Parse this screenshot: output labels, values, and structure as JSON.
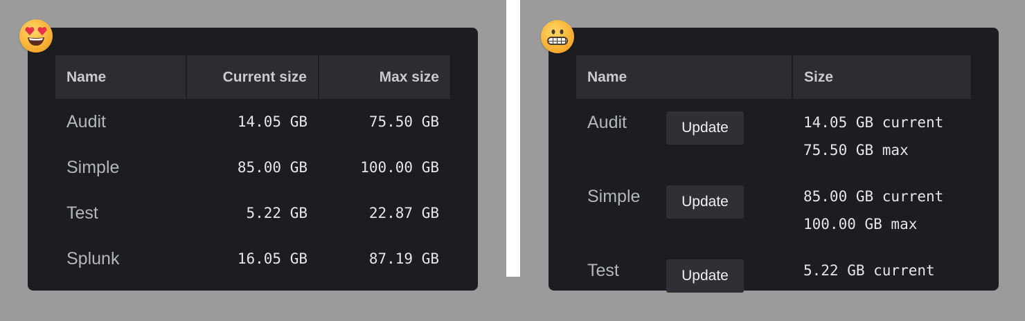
{
  "left_table": {
    "headers": [
      "Name",
      "Current size",
      "Max size"
    ],
    "rows": [
      {
        "name": "Audit",
        "current": "14.05 GB",
        "max": "75.50 GB"
      },
      {
        "name": "Simple",
        "current": "85.00 GB",
        "max": "100.00 GB"
      },
      {
        "name": "Test",
        "current": "5.22 GB",
        "max": "22.87 GB"
      },
      {
        "name": "Splunk",
        "current": "16.05 GB",
        "max": "87.19 GB"
      }
    ]
  },
  "right_table": {
    "headers": [
      "Name",
      "Size"
    ],
    "button_label": "Update",
    "rows": [
      {
        "name": "Audit",
        "current": "14.05 GB current",
        "max": "75.50 GB max"
      },
      {
        "name": "Simple",
        "current": "85.00 GB current",
        "max": "100.00 GB max"
      },
      {
        "name": "Test",
        "current": "5.22 GB current",
        "max": ""
      }
    ]
  },
  "emojis": {
    "left": "heart-eyes-face-icon",
    "right": "grimacing-face-icon"
  },
  "colors": {
    "background": "#9b9b9b",
    "card": "#1c1d21",
    "header": "#2b2d33",
    "button": "#2e3036"
  }
}
